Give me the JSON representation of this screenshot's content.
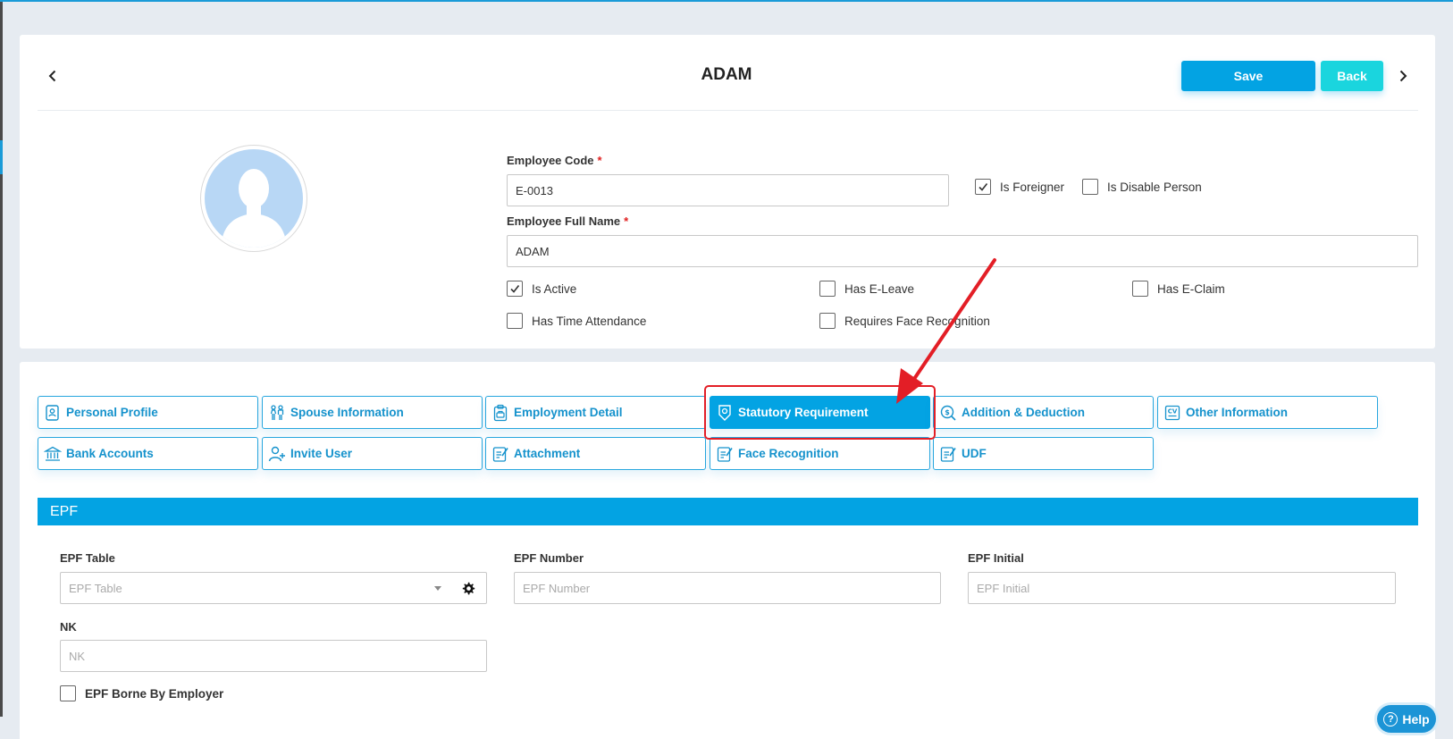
{
  "header": {
    "title": "ADAM",
    "save_label": "Save",
    "back_label": "Back"
  },
  "form": {
    "employee_code": {
      "label": "Employee Code",
      "required": "*",
      "value": "E-0013"
    },
    "full_name": {
      "label": "Employee Full Name",
      "required": "*",
      "value": "ADAM"
    },
    "is_foreigner": {
      "label": "Is Foreigner",
      "checked": true
    },
    "is_disable_person": {
      "label": "Is Disable Person",
      "checked": false
    },
    "is_active": {
      "label": "Is Active",
      "checked": true
    },
    "has_e_leave": {
      "label": "Has E-Leave",
      "checked": false
    },
    "has_e_claim": {
      "label": "Has E-Claim",
      "checked": false
    },
    "has_time_attendance": {
      "label": "Has Time Attendance",
      "checked": false
    },
    "requires_face_recognition": {
      "label": "Requires Face Recognition",
      "checked": false
    }
  },
  "tabs": [
    {
      "label": "Personal Profile",
      "icon": "profile-icon",
      "active": false
    },
    {
      "label": "Spouse Information",
      "icon": "couple-icon",
      "active": false
    },
    {
      "label": "Employment Detail",
      "icon": "clipboard-icon",
      "active": false
    },
    {
      "label": "Statutory Requirement",
      "icon": "badge-icon",
      "active": true
    },
    {
      "label": "Addition & Deduction",
      "icon": "coin-search-icon",
      "active": false
    },
    {
      "label": "Other Information",
      "icon": "cv-icon",
      "active": false
    },
    {
      "label": "Bank Accounts",
      "icon": "bank-icon",
      "active": false
    },
    {
      "label": "Invite User",
      "icon": "user-plus-icon",
      "active": false
    },
    {
      "label": "Attachment",
      "icon": "document-edit-icon",
      "active": false
    },
    {
      "label": "Face Recognition",
      "icon": "document-edit-icon",
      "active": false
    },
    {
      "label": "UDF",
      "icon": "document-edit-icon",
      "active": false
    }
  ],
  "epf": {
    "section_title": "EPF",
    "epf_table": {
      "label": "EPF Table",
      "placeholder": "EPF Table"
    },
    "epf_number": {
      "label": "EPF Number",
      "placeholder": "EPF Number"
    },
    "epf_initial": {
      "label": "EPF Initial",
      "placeholder": "EPF Initial"
    },
    "nk": {
      "label": "NK",
      "placeholder": "NK"
    },
    "borne_by_employer": {
      "label": "EPF Borne By Employer",
      "checked": false
    }
  },
  "help": {
    "label": "Help"
  },
  "colors": {
    "primary": "#03a3e3",
    "back": "#1ad5de",
    "highlight": "#e31e26",
    "background": "#e6ebf1"
  }
}
